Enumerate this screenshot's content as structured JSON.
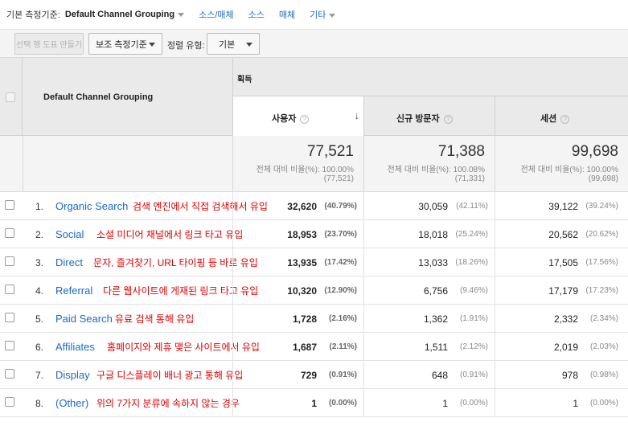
{
  "dimension_bar": {
    "label": "기본 측정기준:",
    "selected": "Default Channel Grouping",
    "links": [
      "소스/매체",
      "소스",
      "매체"
    ],
    "other": "기타"
  },
  "toolbar": {
    "plot_button": "선택 행 도표 만들기",
    "secondary_dimension": "보조 측정기준",
    "sort_label": "정렬 유형:",
    "sort_value": "기본"
  },
  "table": {
    "dimension_header": "Default Channel Grouping",
    "group_header": "획득",
    "metrics": [
      "사용자",
      "신규 방문자",
      "세션"
    ],
    "help_glyph": "?",
    "sort_arrow": "↓",
    "totals": [
      {
        "value": "77,521",
        "pct": "전체 대비 비율(%): 100.00%",
        "of": "(77,521)"
      },
      {
        "value": "71,388",
        "pct": "전체 대비 비율(%): 100.08%",
        "of": "(71,331)"
      },
      {
        "value": "99,698",
        "pct": "전체 대비 비율(%): 100.00%",
        "of": "(99,698)"
      }
    ],
    "rows": [
      {
        "num": "1.",
        "channel": "Organic Search",
        "note": "검색 엔진에서 직접 검색해서 유입",
        "users": "32,620",
        "users_pct": "(40.79%)",
        "new": "30,059",
        "new_pct": "(42.11%)",
        "sessions": "39,122",
        "sessions_pct": "(39.24%)"
      },
      {
        "num": "2.",
        "channel": "Social",
        "note": "소셜 미디어 채널에서 링크 타고 유입",
        "users": "18,953",
        "users_pct": "(23.70%)",
        "new": "18,018",
        "new_pct": "(25.24%)",
        "sessions": "20,562",
        "sessions_pct": "(20.62%)"
      },
      {
        "num": "3.",
        "channel": "Direct",
        "note": "문자, 즐겨찾기, URL 타이핑 등 바로 유입",
        "users": "13,935",
        "users_pct": "(17.42%)",
        "new": "13,033",
        "new_pct": "(18.26%)",
        "sessions": "17,505",
        "sessions_pct": "(17.56%)"
      },
      {
        "num": "4.",
        "channel": "Referral",
        "note": "다른 웹사이트에 게재된 링크 타고 유입",
        "users": "10,320",
        "users_pct": "(12.90%)",
        "new": "6,756",
        "new_pct": "(9.46%)",
        "sessions": "17,179",
        "sessions_pct": "(17.23%)"
      },
      {
        "num": "5.",
        "channel": "Paid Search",
        "note": "유료 검색 통해 유입",
        "users": "1,728",
        "users_pct": "(2.16%)",
        "new": "1,362",
        "new_pct": "(1.91%)",
        "sessions": "2,332",
        "sessions_pct": "(2.34%)"
      },
      {
        "num": "6.",
        "channel": "Affiliates",
        "note": "홈페이지와 제휴 맺은 사이트에서 유입",
        "users": "1,687",
        "users_pct": "(2.11%)",
        "new": "1,511",
        "new_pct": "(2.12%)",
        "sessions": "2,019",
        "sessions_pct": "(2.03%)"
      },
      {
        "num": "7.",
        "channel": "Display",
        "note": "구글 디스플레이 배너 광고 통해 유입",
        "users": "729",
        "users_pct": "(0.91%)",
        "new": "648",
        "new_pct": "(0.91%)",
        "sessions": "978",
        "sessions_pct": "(0.98%)"
      },
      {
        "num": "8.",
        "channel": "(Other)",
        "note": "위의 7가지 분류에 속하지 않는 경우",
        "users": "1",
        "users_pct": "(0.00%)",
        "new": "1",
        "new_pct": "(0.00%)",
        "sessions": "1",
        "sessions_pct": "(0.00%)"
      }
    ]
  },
  "colors": {
    "link": "#1a6bc4",
    "annotation": "#e00000",
    "header_bg": "#eaeaea"
  }
}
